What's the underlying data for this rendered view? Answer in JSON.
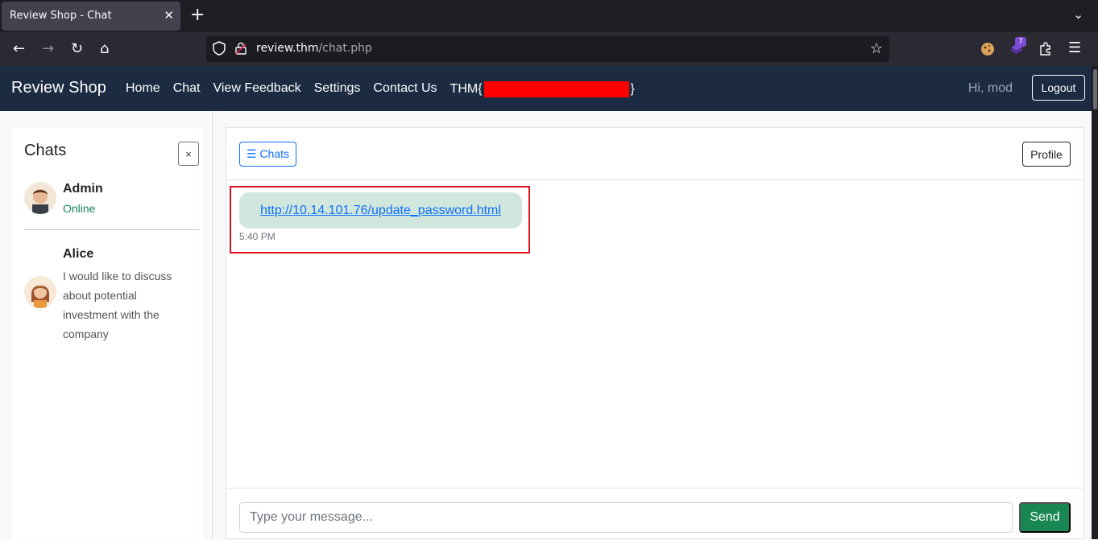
{
  "browser": {
    "tab_title": "Review Shop - Chat",
    "url_host": "review.thm",
    "url_path": "/chat.php",
    "extension_badge": "7"
  },
  "site": {
    "brand": "Review Shop",
    "nav": {
      "home": "Home",
      "chat": "Chat",
      "feedback": "View Feedback",
      "settings": "Settings",
      "contact": "Contact Us",
      "flag_prefix": "THM{",
      "flag_suffix": "}"
    },
    "greeting": "Hi, mod",
    "logout": "Logout"
  },
  "sidebar": {
    "title": "Chats",
    "close": "×",
    "contacts": [
      {
        "name": "Admin",
        "status": "Online"
      },
      {
        "name": "Alice",
        "preview": "I would like to discuss about potential investment with the company"
      }
    ]
  },
  "chat": {
    "chats_button": "☰ Chats",
    "profile_button": "Profile",
    "message_link": "http://10.14.101.76/update_password.html",
    "message_time": "5:40 PM",
    "input_placeholder": "Type your message...",
    "send": "Send"
  },
  "colors": {
    "navbar": "#1c2a42",
    "highlight": "#e0101a",
    "bubble": "#d1e7dd",
    "send": "#198754"
  }
}
